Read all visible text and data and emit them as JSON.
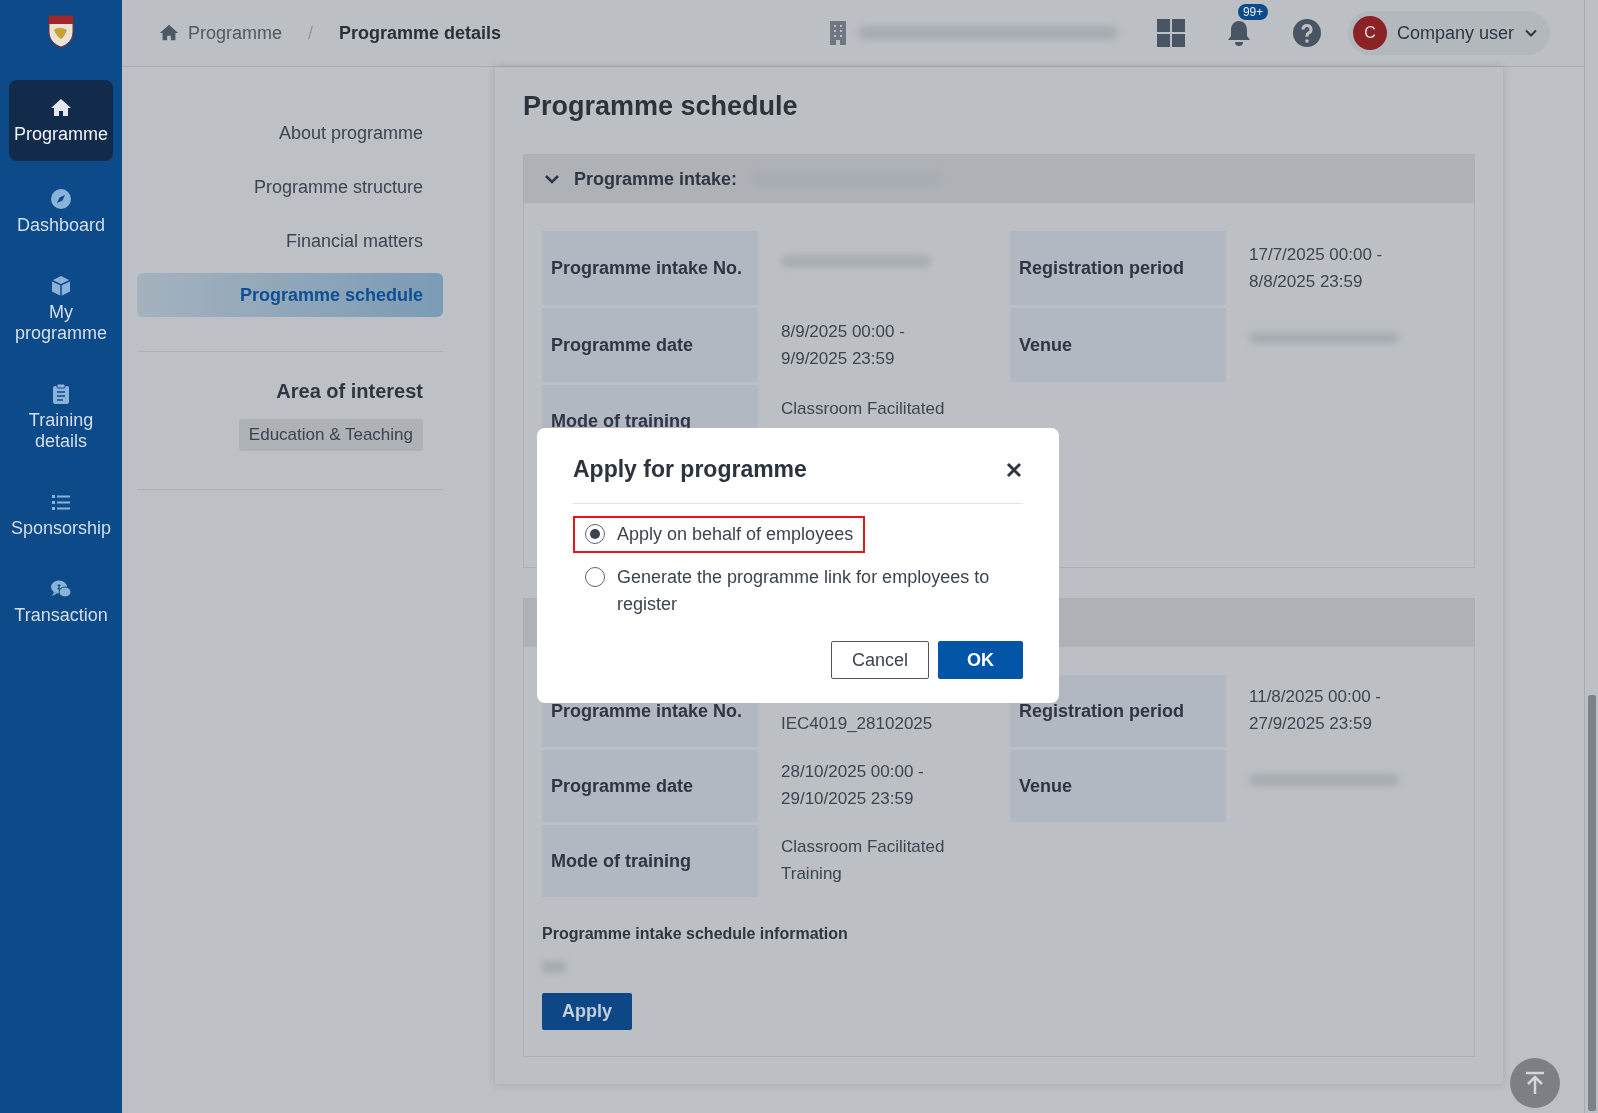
{
  "sidebar": {
    "items": [
      {
        "label": "Programme",
        "selected": true
      },
      {
        "label": "Dashboard",
        "selected": false
      },
      {
        "label": "My programme",
        "selected": false
      },
      {
        "label": "Training details",
        "selected": false
      },
      {
        "label": "Sponsorship",
        "selected": false
      },
      {
        "label": "Transaction",
        "selected": false
      }
    ]
  },
  "breadcrumb": {
    "items": [
      "Programme",
      "Programme details"
    ],
    "separator": "/"
  },
  "header": {
    "notification_badge": "99+",
    "user": {
      "initial": "C",
      "name": "Company user"
    }
  },
  "section_nav": {
    "items": [
      {
        "label": "About programme",
        "selected": false
      },
      {
        "label": "Programme structure",
        "selected": false
      },
      {
        "label": "Financial matters",
        "selected": false
      },
      {
        "label": "Programme schedule",
        "selected": true
      }
    ],
    "area_heading": "Area of interest",
    "tags": [
      "Education & Teaching"
    ]
  },
  "schedule": {
    "title": "Programme schedule",
    "intakes": [
      {
        "header_label": "Programme intake:",
        "expanded": true,
        "fields": [
          {
            "label": "Programme intake No.",
            "redacted": true
          },
          {
            "label": "Registration period",
            "lines": [
              "17/7/2025 00:00 -",
              "8/8/2025 23:59"
            ]
          },
          {
            "label": "Programme date",
            "lines": [
              "8/9/2025 00:00 -",
              "9/9/2025 23:59"
            ]
          },
          {
            "label": "Venue",
            "redacted": true
          },
          {
            "label": "Mode of training",
            "lines": [
              "Classroom Facilitated"
            ]
          }
        ]
      },
      {
        "fields": [
          {
            "label": "Programme intake No.",
            "lines": [
              "IEC4019_28102025"
            ]
          },
          {
            "label": "Registration period",
            "lines": [
              "11/8/2025 00:00 -",
              "27/9/2025 23:59"
            ]
          },
          {
            "label": "Programme date",
            "lines": [
              "28/10/2025 00:00 -",
              "29/10/2025 23:59"
            ]
          },
          {
            "label": "Venue",
            "redacted": true
          },
          {
            "label": "Mode of training",
            "lines": [
              "Classroom Facilitated",
              "Training"
            ]
          }
        ],
        "info_heading": "Programme intake schedule information",
        "apply_label": "Apply"
      }
    ]
  },
  "dialog": {
    "title": "Apply for programme",
    "options": [
      {
        "label": "Apply on behalf of employees",
        "selected": true,
        "highlighted": true
      },
      {
        "label": "Generate the programme link for employees to register",
        "selected": false,
        "highlighted": false
      }
    ],
    "buttons": [
      {
        "label": "Cancel",
        "kind": "secondary"
      },
      {
        "label": "OK",
        "kind": "primary"
      }
    ]
  }
}
